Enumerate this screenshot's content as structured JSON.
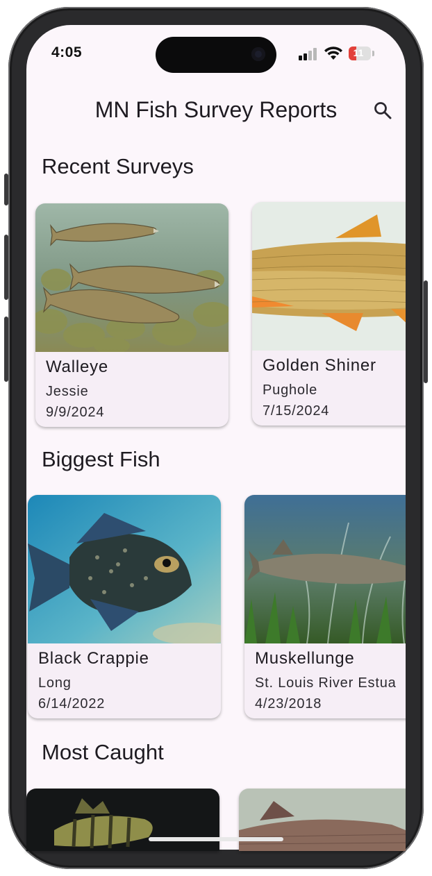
{
  "status_bar": {
    "time": "4:05",
    "battery": "11"
  },
  "app_bar": {
    "title": "MN Fish Survey Reports",
    "search_icon": "search-icon"
  },
  "sections": {
    "recent": {
      "title": "Recent Surveys",
      "cards": [
        {
          "name": "Walleye",
          "location": "Jessie",
          "date": "9/9/2024"
        },
        {
          "name": "Golden Shiner",
          "location": "Pughole",
          "date": "7/15/2024"
        }
      ]
    },
    "biggest": {
      "title": "Biggest Fish",
      "cards": [
        {
          "name": "Black Crappie",
          "location": "Long",
          "date": "6/14/2022"
        },
        {
          "name": "Muskellunge",
          "location": "St. Louis River Estua",
          "date": "4/23/2018"
        }
      ]
    },
    "most_caught": {
      "title": "Most Caught"
    }
  },
  "colors": {
    "background": "#fcf6fb",
    "card_background": "#f6eef6",
    "text": "#1e1b21",
    "battery_low": "#e2413b"
  }
}
